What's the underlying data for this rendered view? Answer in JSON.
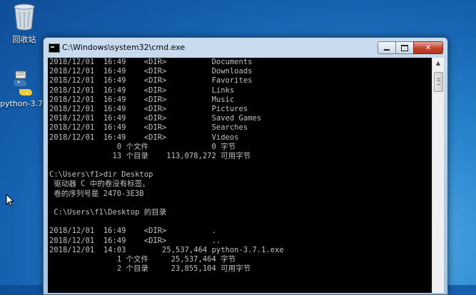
{
  "desktop": {
    "icons": [
      {
        "label": "回收站",
        "icon": "recycle-bin-icon"
      },
      {
        "label": "python-3.7.:",
        "icon": "python-installer-icon"
      }
    ]
  },
  "window": {
    "title": "C:\\Windows\\system32\\cmd.exe",
    "icon": "cmd-icon",
    "controls": {
      "minimize": "minimize-icon",
      "maximize": "maximize-icon",
      "close_label": "✕"
    }
  },
  "console": {
    "lines": [
      "2018/12/01  16:49    <DIR>          Documents",
      "2018/12/01  16:49    <DIR>          Downloads",
      "2018/12/01  16:49    <DIR>          Favorites",
      "2018/12/01  16:49    <DIR>          Links",
      "2018/12/01  16:49    <DIR>          Music",
      "2018/12/01  16:49    <DIR>          Pictures",
      "2018/12/01  16:49    <DIR>          Saved Games",
      "2018/12/01  16:49    <DIR>          Searches",
      "2018/12/01  16:49    <DIR>          Videos",
      "               0 个文件              0 字节",
      "              13 个目录    113,078,272 可用字节",
      "",
      "C:\\Users\\f1>dir Desktop",
      " 驱动器 C 中的卷没有标签。",
      " 卷的序列号是 2470-3E3B",
      "",
      " C:\\Users\\f1\\Desktop 的目录",
      "",
      "2018/12/01  16:49    <DIR>          .",
      "2018/12/01  16:49    <DIR>          ..",
      "2018/12/01  14:03        25,537,464 python-3.7.1.exe",
      "               1 个文件     25,537,464 字节",
      "               2 个目录     23,855,104 可用字节"
    ]
  }
}
